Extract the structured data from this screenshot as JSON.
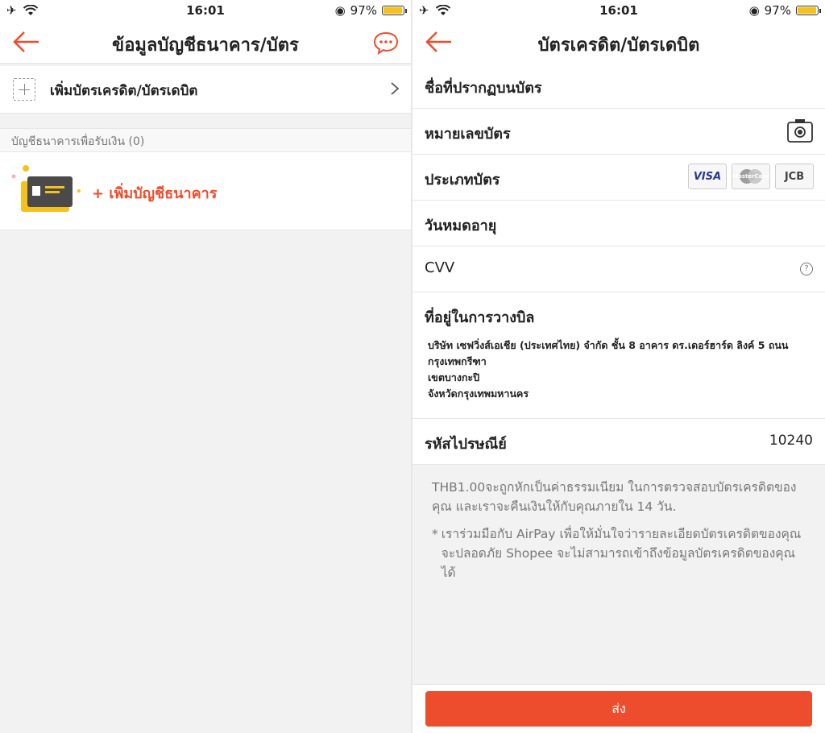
{
  "status_bar": {
    "time": "16:01",
    "battery": "97%",
    "battery_level": 0.97
  },
  "left": {
    "title": "ข้อมูลบัญชีธนาคาร/บัตร",
    "add_card_label": "เพิ่มบัตรเครดิต/บัตรเดบิต",
    "bank_section_header": "บัญชีธนาคารเพื่อรับเงิน (0)",
    "add_bank_label": "+ เพิ่มบัญชีธนาคาร"
  },
  "right": {
    "title": "บัตรเครดิต/บัตรเดบิต",
    "fields": {
      "cardholder_name": "ชื่อที่ปรากฏบนบัตร",
      "card_number": "หมายเลขบัตร",
      "card_type": "ประเภทบัตร",
      "expiry": "วันหมดอายุ",
      "cvv": "CVV",
      "billing_address": "ที่อยู่ในการวางบิล",
      "postal_code": "รหัสไปรษณีย์"
    },
    "card_logos": [
      "VISA",
      "MasterCard",
      "JCB"
    ],
    "billing_address_lines": [
      "บริษัท เซฟวิ่งส์เอเชีย (ประเทศไทย) จำกัด ชั้น 8 อาคาร ดร.เดอร์ฮาร์ด ลิงค์ 5 ถนน",
      "กรุงเทพกรีฑา",
      "เขตบางกะปิ",
      "จังหวัดกรุงเทพมหานคร"
    ],
    "postal_code_value": "10240",
    "note_fee": "THB1.00จะถูกหักเป็นค่าธรรมเนียม ในการตรวจสอบบัตรเครดิตของคุณ และเราจะคืนเงินให้กับคุณภายใน 14 วัน.",
    "note_asterisk": "*",
    "note_security": "เราร่วมมือกับ AirPay เพื่อให้มั่นใจว่ารายละเอียดบัตรเครดิตของคุณจะปลอดภัย Shopee จะไม่สามารถเข้าถึงข้อมูลบัตรเครดิตของคุณได้",
    "submit_label": "ส่ง"
  },
  "colors": {
    "accent": "#ee4d2d",
    "background": "#f2f2f2",
    "battery": "#f5c21b"
  },
  "icons": [
    "airplane-icon",
    "wifi-icon",
    "back-arrow-icon",
    "chat-icon",
    "plus-icon",
    "chevron-right-icon",
    "camera-icon",
    "help-icon",
    "orientation-lock-icon"
  ]
}
